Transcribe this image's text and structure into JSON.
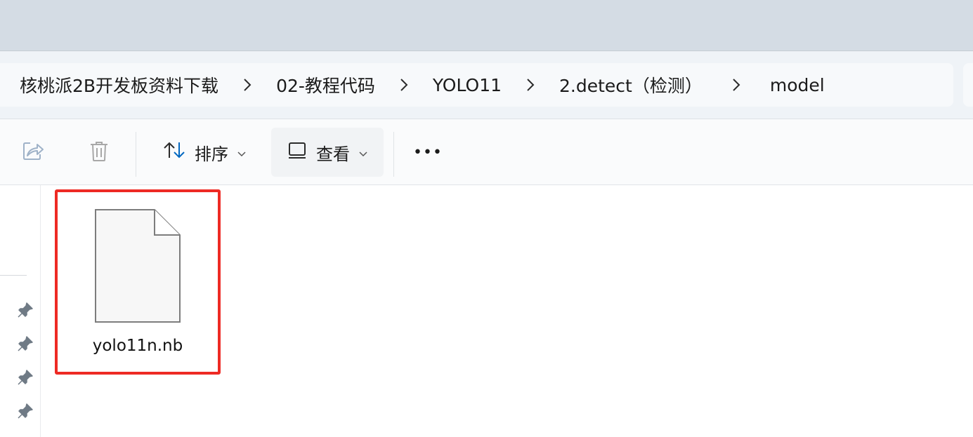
{
  "breadcrumb": {
    "items": [
      {
        "label": "核桃派2B开发板资料下载"
      },
      {
        "label": "02-教程代码"
      },
      {
        "label": "YOLO11"
      },
      {
        "label": "2.detect（检测）"
      },
      {
        "label": "model"
      }
    ],
    "separator_icon": "chevron-right-icon"
  },
  "toolbar": {
    "share_icon": "share-icon",
    "delete_icon": "trash-icon",
    "sort_label": "排序",
    "sort_icon": "sort-arrows-icon",
    "view_label": "查看",
    "view_icon": "view-layout-icon",
    "more_label": "•••"
  },
  "quick_access": {
    "pins": [
      "pin-icon",
      "pin-icon",
      "pin-icon",
      "pin-icon"
    ]
  },
  "files": [
    {
      "name": "yolo11n.nb",
      "icon": "generic-file-icon",
      "selected": true
    }
  ],
  "colors": {
    "highlight": "#ee2a24",
    "accent": "#0067c0"
  }
}
